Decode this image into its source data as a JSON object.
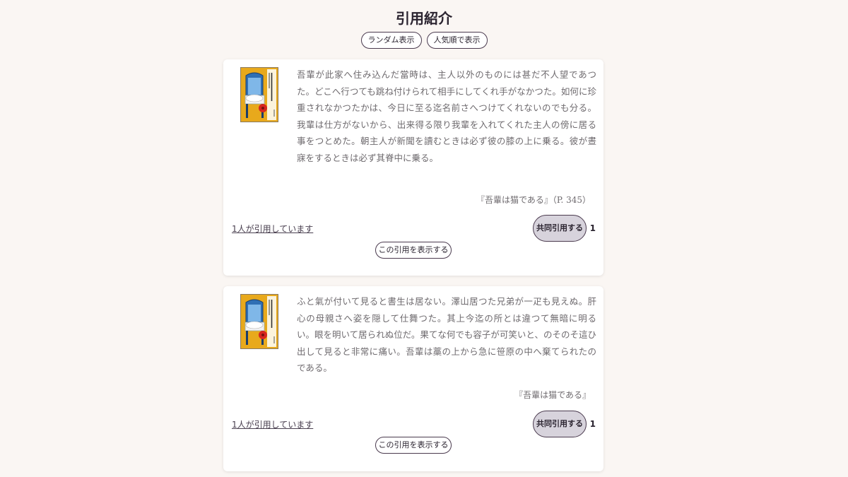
{
  "header": {
    "title": "引用紹介",
    "sort_random_label": "ランダム表示",
    "sort_popular_label": "人気順で表示"
  },
  "quotes": [
    {
      "text": "吾輩が此家へ住み込んだ當時は、主人以外のものには甚だ不人望であつた。どこへ行つても跳ね付けられて相手にしてくれ手がなかつた。如何に珍重されなかつたかは、今日に至る迄名前さへつけてくれないのでも分る。我輩は仕方がないから、出来得る限り我輩を入れてくれた主人の傍に居る事をつとめた。朝主人が新聞を讀むときは必ず彼の膝の上に乗る。彼が晝寐をするときは必ず其脊中に乗る。",
      "source": "『吾輩は猫である』（P. 345）",
      "cited_by": "1人が引用しています",
      "co_cite_label": "共同引用する",
      "co_cite_count": "1",
      "show_label": "この引用を表示する",
      "cover_icon": "book-cover-icon"
    },
    {
      "text": "ふと氣が付いて見ると書生は居ない。澤山居つた兄弟が一疋も見えぬ。肝心の母親さへ姿を隠して仕舞つた。其上今迄の所とは違つて無暗に明るい。眼を明いて居られぬ位だ。果てな何でも容子が可笑いと、のそのそ這ひ出して見ると非常に痛い。吾輩は藁の上から急に笹原の中へ棄てられたのである。",
      "source": "『吾輩は猫である』",
      "cited_by": "1人が引用しています",
      "co_cite_label": "共同引用する",
      "co_cite_count": "1",
      "show_label": "この引用を表示する",
      "cover_icon": "book-cover-icon"
    }
  ],
  "colors": {
    "background": "#faf6f3",
    "card": "#ffffff",
    "accent_border": "#4a3a4e",
    "co_cite_fill": "#d7d3dc",
    "quote_text": "#6e6a6e"
  }
}
